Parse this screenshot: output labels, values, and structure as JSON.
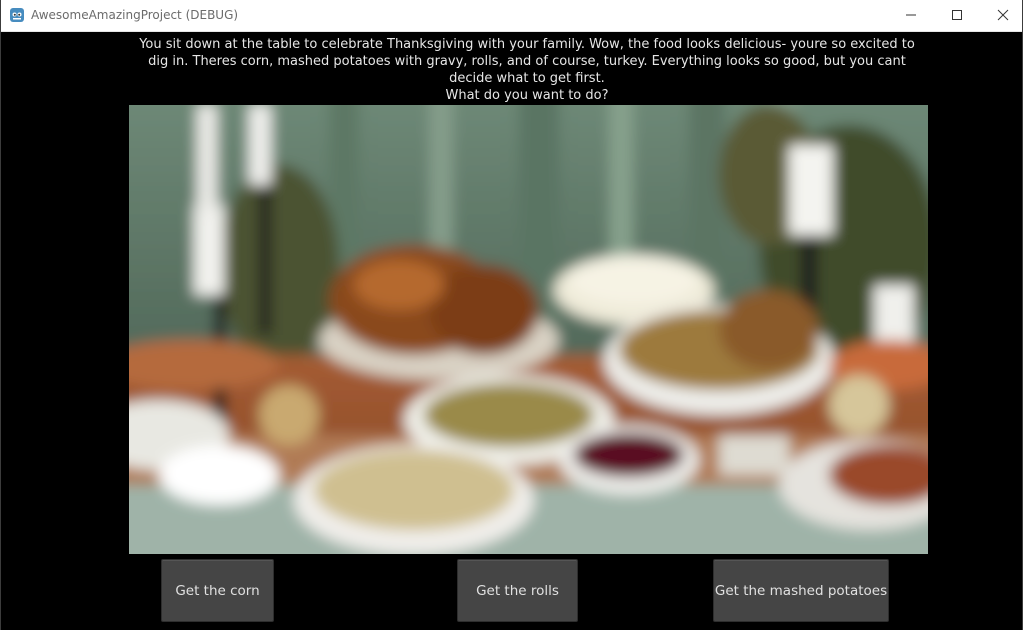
{
  "window": {
    "title": "AwesomeAmazingProject (DEBUG)",
    "icon": "godot-engine-icon"
  },
  "story": {
    "line1": "You sit down at the table to celebrate Thanksgiving with your family. Wow, the food looks delicious- youre so excited to",
    "line2": "dig in. Theres corn, mashed potatoes with gravy, rolls, and of course, turkey. Everything looks so good, but you cant",
    "line3": "decide what to get first.",
    "prompt": "What do you want to do?"
  },
  "choices": [
    {
      "label": "Get the corn"
    },
    {
      "label": "Get the rolls"
    },
    {
      "label": "Get the mashed potatoes"
    }
  ],
  "colors": {
    "background": "#000000",
    "button": "#454545",
    "text": "#e6e6e6"
  }
}
